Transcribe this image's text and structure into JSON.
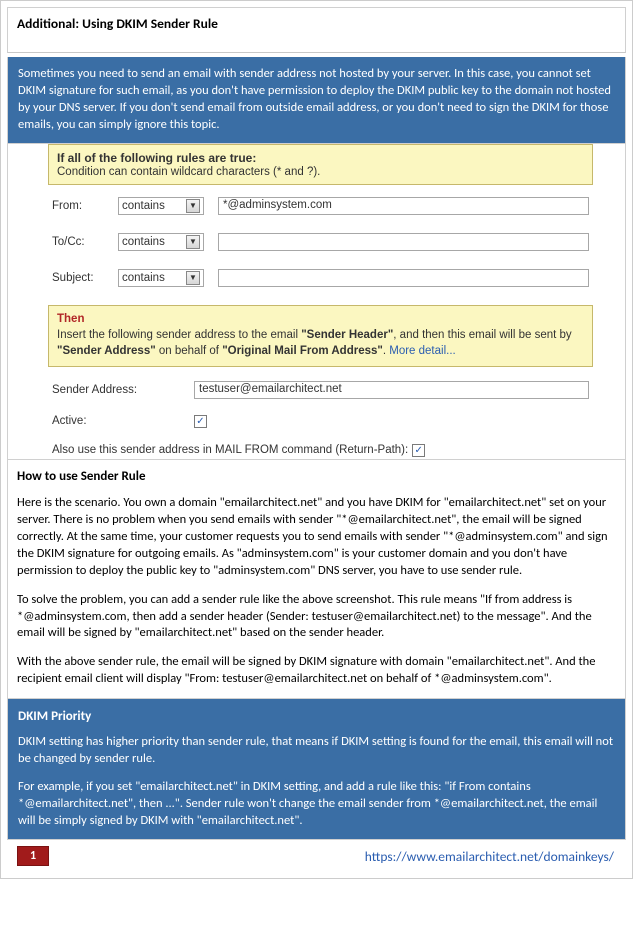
{
  "header": {
    "title": "Additional: Using DKIM Sender Rule"
  },
  "intro": {
    "text": "Sometimes you need to send an email with sender address not hosted by your server. In this case, you cannot set DKIM signature for such email, as you don't have permission to deploy the DKIM public key to the domain not hosted by your DNS server. If you don't send email from outside email address, or you don't need to sign the DKIM for those emails, you can simply ignore this topic."
  },
  "form": {
    "rules_title": "If all of the following rules are true:",
    "rules_sub": "Condition can contain wildcard characters (* and ?).",
    "from_label": "From:",
    "tocc_label": "To/Cc:",
    "subject_label": "Subject:",
    "op_contains": "contains",
    "from_value": "*@adminsystem.com",
    "then_label": "Then",
    "then_text_a": "Insert the following sender address to the email ",
    "then_hl_a": "\"Sender Header\"",
    "then_text_b": ", and then this email will be sent by ",
    "then_hl_b": "\"Sender Address\"",
    "then_text_c": " on behalf of ",
    "then_hl_c": "\"Original Mail From Address\"",
    "then_text_d": ". ",
    "then_link": "More detail...",
    "sender_label": "Sender Address:",
    "sender_value": "testuser@emailarchitect.net",
    "active_label": "Active:",
    "check_mark": "✓",
    "also_text": "Also use this sender address in MAIL FROM command (Return-Path):"
  },
  "howto": {
    "title": "How to use Sender Rule",
    "p1": "Here is the scenario. You own a domain \"emailarchitect.net\" and you have DKIM for \"emailarchitect.net\" set on your server. There is no problem when you send emails with sender \"*@emailarchitect.net\", the email will be signed correctly. At the same time, your customer requests you to send emails with sender \"*@adminsystem.com\" and sign the DKIM signature for outgoing emails. As \"adminsystem.com\" is your customer domain and you don't have permission to deploy the public key to \"adminsystem.com\" DNS server, you have to use sender rule.",
    "p2": "To solve the problem, you can add a sender rule like the above screenshot. This rule means \"If from address is *@adminsystem.com, then add a sender header (Sender: testuser@emailarchitect.net) to the message\". And the email will be signed by \"emailarchitect.net\" based on the sender header.",
    "p3": "With the above sender rule, the email will be signed by DKIM signature with domain \"emailarchitect.net\". And the recipient email client will display \"From: testuser@emailarchitect.net on behalf of *@adminsystem.com\"."
  },
  "priority": {
    "title": "DKIM Priority",
    "p1": "DKIM setting has higher priority than sender rule, that means if DKIM setting is found for the email, this email will not be changed by sender rule.",
    "p2": "For example, if you set \"emailarchitect.net\" in DKIM setting, and add a rule like this: \"if From contains *@emailarchitect.net\", then ...\". Sender rule won't change the email sender from *@emailarchitect.net, the email will be simply signed by DKIM with \"emailarchitect.net\"."
  },
  "footer": {
    "page": "1",
    "link": "https://www.emailarchitect.net/domainkeys/"
  }
}
